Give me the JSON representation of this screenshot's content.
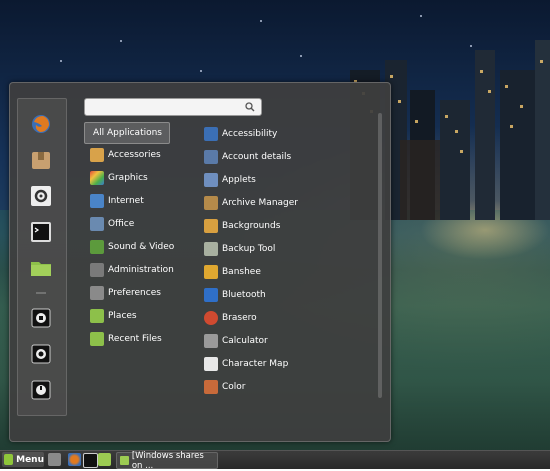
{
  "search": {
    "placeholder": ""
  },
  "favorites": [
    {
      "name": "firefox-icon"
    },
    {
      "name": "software-manager-icon"
    },
    {
      "name": "system-settings-icon"
    },
    {
      "name": "terminal-icon"
    },
    {
      "name": "home-folder-icon"
    },
    {
      "name": "lock-screen-icon"
    },
    {
      "name": "logout-icon"
    },
    {
      "name": "power-icon"
    }
  ],
  "categories": [
    {
      "label": "All Applications",
      "icon": "all-apps-icon",
      "active": true
    },
    {
      "label": "Accessories",
      "icon": "accessories-icon",
      "color": "#d8a24a"
    },
    {
      "label": "Graphics",
      "icon": "graphics-icon",
      "color": "#c4473c"
    },
    {
      "label": "Internet",
      "icon": "internet-icon",
      "color": "#4a84c8"
    },
    {
      "label": "Office",
      "icon": "office-icon",
      "color": "#6a8ab0"
    },
    {
      "label": "Sound & Video",
      "icon": "sound-video-icon",
      "color": "#5c9a3c"
    },
    {
      "label": "Administration",
      "icon": "administration-icon",
      "color": "#7a7a7a"
    },
    {
      "label": "Preferences",
      "icon": "preferences-icon",
      "color": "#8a8a8a"
    },
    {
      "label": "Places",
      "icon": "places-icon",
      "color": "#8dc04a"
    },
    {
      "label": "Recent Files",
      "icon": "recent-files-icon",
      "color": "#8dc04a"
    }
  ],
  "apps": [
    {
      "label": "Accessibility",
      "icon": "accessibility-icon",
      "color": "#3b6fb5"
    },
    {
      "label": "Account details",
      "icon": "account-details-icon",
      "color": "#5a7aa8"
    },
    {
      "label": "Applets",
      "icon": "applets-icon",
      "color": "#6f8fbf"
    },
    {
      "label": "Archive Manager",
      "icon": "archive-manager-icon",
      "color": "#b58a4a"
    },
    {
      "label": "Backgrounds",
      "icon": "backgrounds-icon",
      "color": "#d8a040"
    },
    {
      "label": "Backup Tool",
      "icon": "backup-tool-icon",
      "color": "#a8b0a0"
    },
    {
      "label": "Banshee",
      "icon": "banshee-icon",
      "color": "#e0a830"
    },
    {
      "label": "Bluetooth",
      "icon": "bluetooth-icon",
      "color": "#2f6fc8"
    },
    {
      "label": "Brasero",
      "icon": "brasero-icon",
      "color": "#d04a30"
    },
    {
      "label": "Calculator",
      "icon": "calculator-icon",
      "color": "#9a9a9a"
    },
    {
      "label": "Character Map",
      "icon": "character-map-icon",
      "color": "#e8e8e8"
    },
    {
      "label": "Color",
      "icon": "color-icon",
      "color": "#c86a3a"
    }
  ],
  "taskbar": {
    "menu_label": "Menu",
    "window_title": "[Windows shares on ..."
  }
}
